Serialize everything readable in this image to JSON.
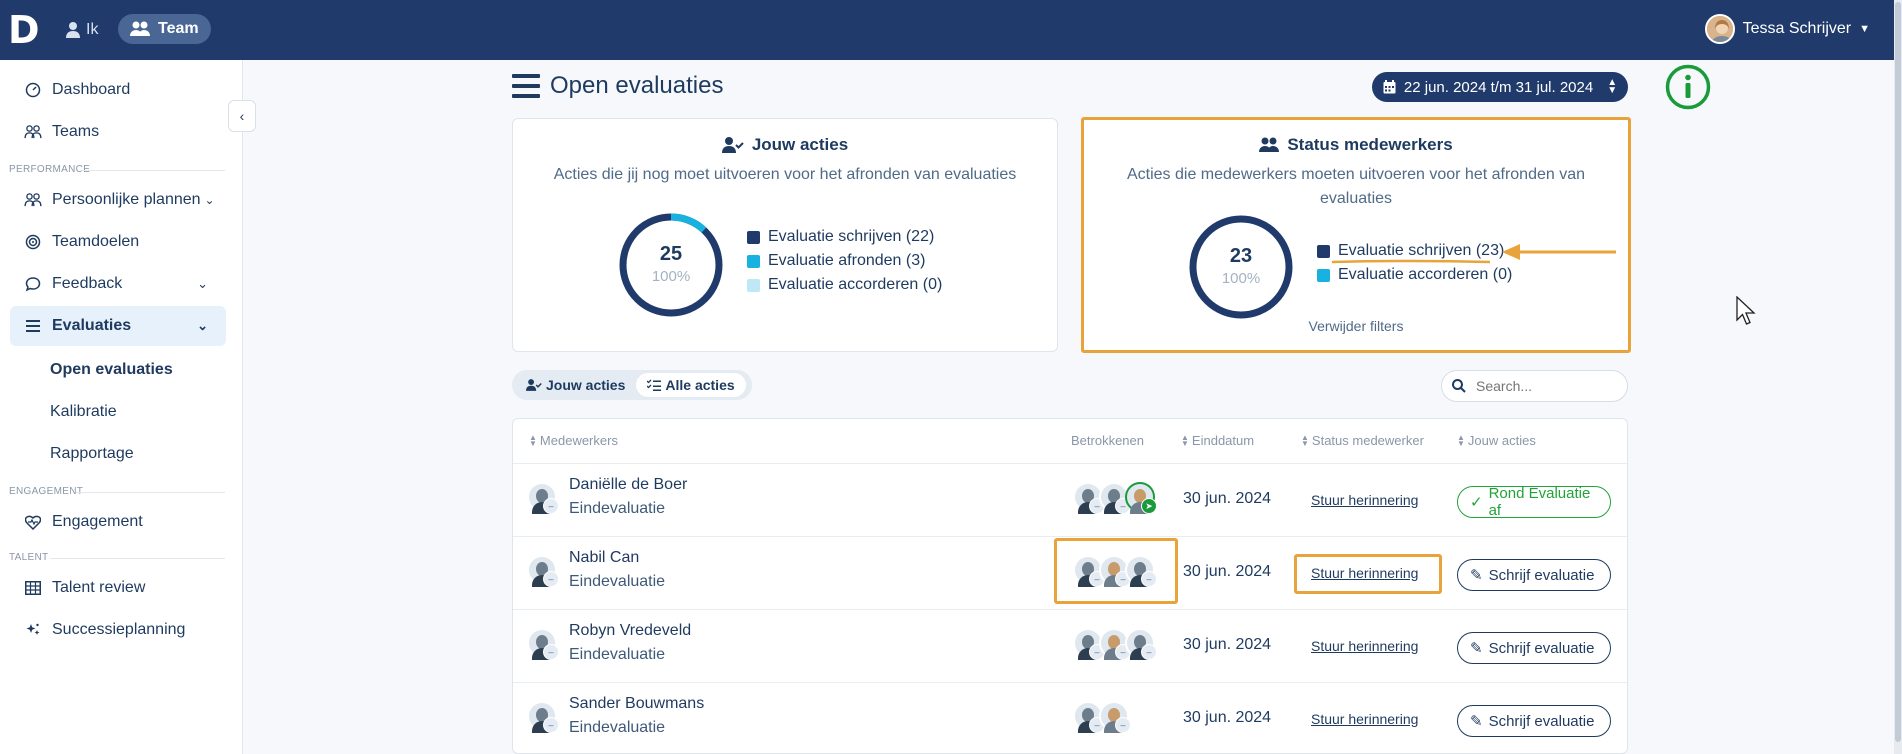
{
  "topbar": {
    "logo": "D",
    "nav_ik": "Ik",
    "nav_team": "Team",
    "user_name": "Tessa Schrijver"
  },
  "sidebar": {
    "items": {
      "dashboard": "Dashboard",
      "teams": "Teams",
      "section_performance": "PERFORMANCE",
      "persoonlijke_plannen": "Persoonlijke plannen",
      "teamdoelen": "Teamdoelen",
      "feedback": "Feedback",
      "evaluaties": "Evaluaties",
      "open_evaluaties": "Open evaluaties",
      "kalibratie": "Kalibratie",
      "rapportage": "Rapportage",
      "section_engagement": "ENGAGEMENT",
      "engagement": "Engagement",
      "section_talent": "TALENT",
      "talent_review": "Talent review",
      "successieplanning": "Successieplanning"
    }
  },
  "main": {
    "title": "Open evaluaties",
    "date_range": "22 jun. 2024 t/m 31 jul. 2024",
    "jouw_acties": {
      "title": "Jouw acties",
      "desc": "Acties die jij nog moet uitvoeren voor het afronden van evaluaties",
      "total": "25",
      "percent": "100%",
      "legend": [
        {
          "label": "Evaluatie schrijven (22)",
          "color": "#1f3a6b",
          "value": 22
        },
        {
          "label": "Evaluatie afronden (3)",
          "color": "#17b2e0",
          "value": 3
        },
        {
          "label": "Evaluatie accorderen (0)",
          "color": "#bfe8f6",
          "value": 0
        }
      ]
    },
    "status_medewerkers": {
      "title": "Status medewerkers",
      "desc": "Acties die medewerkers moeten uitvoeren voor het afronden van evaluaties",
      "total": "23",
      "percent": "100%",
      "legend": [
        {
          "label": "Evaluatie schrijven (23)",
          "color": "#1f3a6b",
          "value": 23
        },
        {
          "label": "Evaluatie accorderen (0)",
          "color": "#17b2e0",
          "value": 0
        }
      ],
      "remove_filters": "Verwijder filters"
    },
    "toggle": {
      "jouw": "Jouw acties",
      "alle": "Alle acties"
    },
    "search_placeholder": "Search...",
    "table": {
      "headers": {
        "medewerkers": "Medewerkers",
        "betrokkenen": "Betrokkenen",
        "einddatum": "Einddatum",
        "status": "Status medewerker",
        "acties": "Jouw acties"
      },
      "rows": [
        {
          "name": "Daniëlle de Boer",
          "type": "Eindevaluatie",
          "date": "30 jun. 2024",
          "status": "Stuur herinnering",
          "action": "Rond Evaluatie af"
        },
        {
          "name": "Nabil Can",
          "type": "Eindevaluatie",
          "date": "30 jun. 2024",
          "status": "Stuur herinnering",
          "action": "Schrijf evaluatie"
        },
        {
          "name": "Robyn Vredeveld",
          "type": "Eindevaluatie",
          "date": "30 jun. 2024",
          "status": "Stuur herinnering",
          "action": "Schrijf evaluatie"
        },
        {
          "name": "Sander Bouwmans",
          "type": "Eindevaluatie",
          "date": "30 jun. 2024",
          "status": "Stuur herinnering",
          "action": "Schrijf evaluatie"
        }
      ]
    }
  },
  "colors": {
    "navy": "#1f3a6b",
    "highlight": "#e8a33a",
    "green": "#22a33a",
    "cyan": "#17b2e0"
  }
}
